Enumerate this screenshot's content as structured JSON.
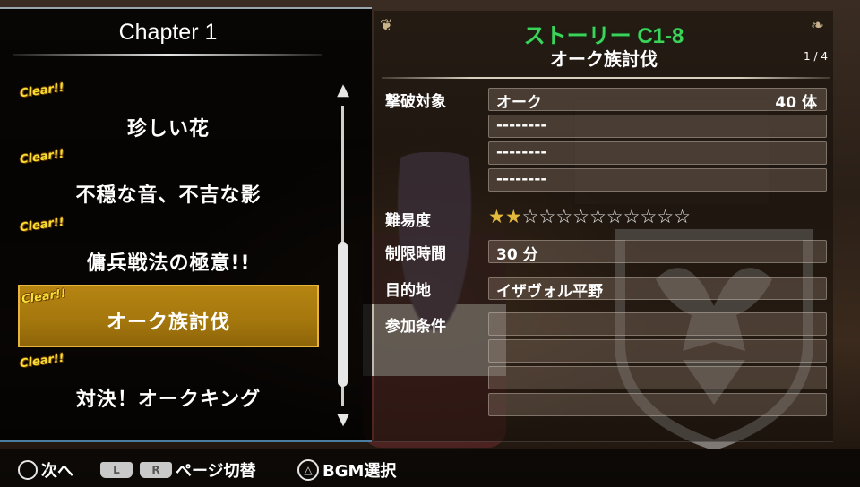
{
  "chapter": {
    "title": "Chapter 1",
    "clear_badge": "Clear!!",
    "quests": [
      {
        "label": "珍しい花",
        "cleared": true,
        "selected": false
      },
      {
        "label": "不穏な音、不吉な影",
        "cleared": true,
        "selected": false
      },
      {
        "label": "傭兵戦法の極意!!",
        "cleared": true,
        "selected": false
      },
      {
        "label": "オーク族討伐",
        "cleared": true,
        "selected": true
      },
      {
        "label": "対決！オークキング",
        "cleared": true,
        "selected": false
      }
    ]
  },
  "detail": {
    "story_code": "ストーリー C1-8",
    "story_name": "オーク族討伐",
    "page": "1 / 4",
    "targets_label": "撃破対象",
    "targets": [
      {
        "name": "オーク",
        "count": "40 体"
      },
      {
        "name": "--------",
        "count": ""
      },
      {
        "name": "--------",
        "count": ""
      },
      {
        "name": "--------",
        "count": ""
      }
    ],
    "difficulty_label": "難易度",
    "difficulty": {
      "filled": 2,
      "total": 12
    },
    "time_limit_label": "制限時間",
    "time_limit": "30 分",
    "destination_label": "目的地",
    "destination": "イザヴォル平野",
    "conditions_label": "参加条件",
    "conditions": [
      "",
      "",
      "",
      ""
    ]
  },
  "controls": {
    "next_label": "次へ",
    "l_key": "L",
    "r_key": "R",
    "page_switch_label": "ページ切替",
    "bgm_label": "BGM選択"
  },
  "colors": {
    "story_code": "#3cd35a",
    "selected_item": "#a4770d",
    "clear_badge": "#f6df33",
    "star_filled": "#e2b93a"
  }
}
